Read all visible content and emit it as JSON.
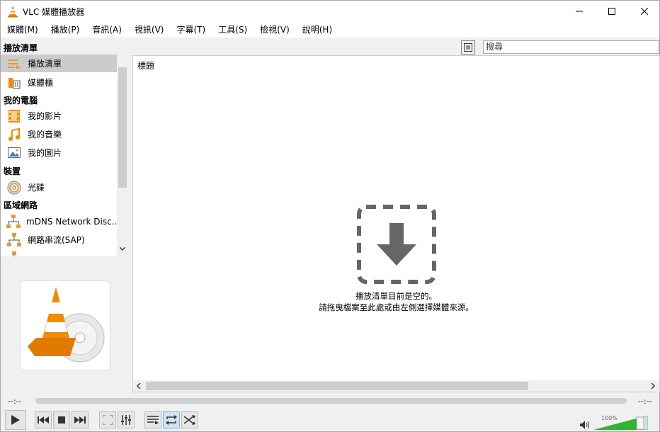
{
  "window": {
    "title": "VLC 媒體播放器",
    "minimize_icon": "minimize-icon",
    "maximize_icon": "maximize-icon",
    "close_icon": "close-icon"
  },
  "menu": [
    "媒體(M)",
    "播放(P)",
    "音訊(A)",
    "視訊(V)",
    "字幕(T)",
    "工具(S)",
    "檢視(V)",
    "說明(H)"
  ],
  "sidebar": {
    "header": "播放清單",
    "playlist_items": [
      {
        "label": "播放清單",
        "icon": "playlist-icon",
        "selected": true
      },
      {
        "label": "媒體櫃",
        "icon": "media-library-icon",
        "selected": false
      }
    ],
    "my_computer": {
      "title": "我的電腦",
      "items": [
        {
          "label": "我的影片",
          "icon": "film-icon"
        },
        {
          "label": "我的音樂",
          "icon": "music-note-icon"
        },
        {
          "label": "我的圖片",
          "icon": "picture-icon"
        }
      ]
    },
    "devices": {
      "title": "裝置",
      "items": [
        {
          "label": "光碟",
          "icon": "disc-icon"
        }
      ]
    },
    "network": {
      "title": "區域網路",
      "items": [
        {
          "label": "mDNS Network Disc...",
          "icon": "network-icon"
        },
        {
          "label": "網路串流(SAP)",
          "icon": "network-icon"
        }
      ]
    }
  },
  "playlist": {
    "column_title": "標題",
    "search_placeholder": "搜尋",
    "empty_line1": "播放清單目前是空的。",
    "empty_line2": "請拖曳檔案至此處或由左側選擇媒體來源。"
  },
  "seek": {
    "elapsed": "--:--",
    "remaining": "--:--"
  },
  "volume": {
    "percent_label": "100%",
    "level": 1.0
  },
  "colors": {
    "accent_orange": "#f08c00",
    "volume_green": "#2db52d",
    "selection_gray": "#cccccc"
  }
}
